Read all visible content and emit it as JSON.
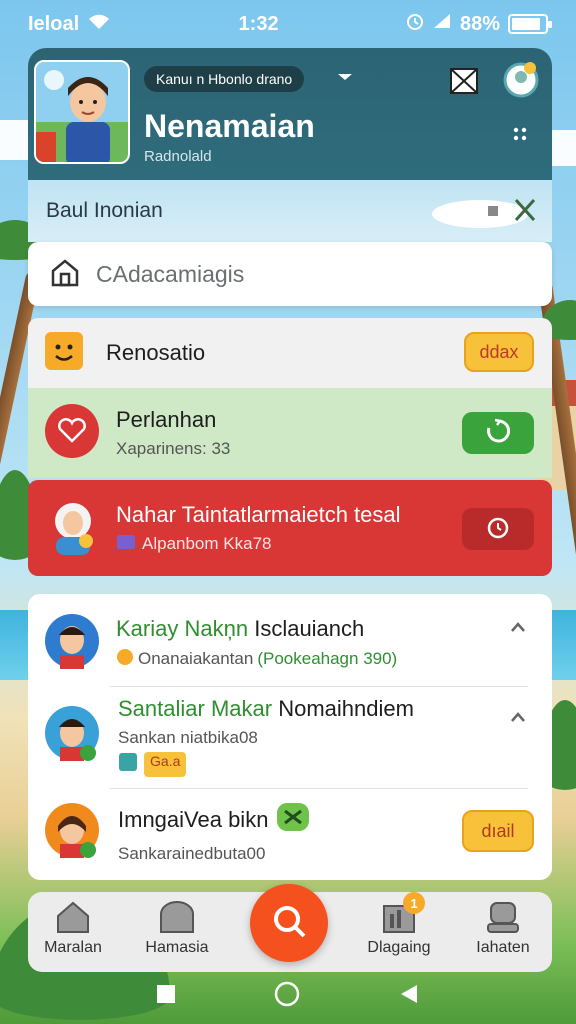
{
  "status_bar": {
    "carrier": "Ieloal",
    "time": "1:32",
    "battery_percent": "88%",
    "battery_level": 0.88
  },
  "header": {
    "pill": "Kanuı n Hbonlo drano",
    "title": "Nenamaian",
    "subtitle": "Radnolald",
    "icons": [
      "play-arrow-icon",
      "mail-icon",
      "profile-badge-icon",
      "dots-icon"
    ]
  },
  "subheader": {
    "label": "Baul Inonian"
  },
  "search": {
    "placeholder": "CAdacamiagis"
  },
  "rows": [
    {
      "title": "Renosatio",
      "button": "ddax",
      "bg": "#f1f1f1",
      "button_color": "#f7c13a"
    },
    {
      "title": "Perlanhan",
      "subtitle": "Xaparinens: 33",
      "bg": "#cfe9c6",
      "button_color": "#3aa33c"
    },
    {
      "title": "Nahar Taintatlarmaietch tesal",
      "subtitle": "Alpanbom Kka78",
      "bg": "#d93636",
      "button_color": "#b92a2a"
    }
  ],
  "contacts": [
    {
      "name_colored": "Kariay Nakņn",
      "name_plain": "Isclauianch",
      "detail_plain": "Onanaiakantan",
      "detail_colored": "(Pookeahagn 390)",
      "badge": ""
    },
    {
      "name_colored": "Santaliar Makar",
      "name_plain": "Nomaihndiem",
      "detail_plain": "Sankan niatbika08",
      "detail_colored": "",
      "badge": "Ga.a"
    },
    {
      "name_colored": "",
      "name_plain": "ImngaiVea bikn",
      "detail_plain": "Sankarainedbuta00",
      "detail_colored": "",
      "badge": "",
      "button": "dıail"
    }
  ],
  "nav": {
    "items": [
      {
        "label": "Maralan",
        "icon": "home-icon"
      },
      {
        "label": "Hamasia",
        "icon": "gallery-icon"
      },
      {
        "label": "Dlagaing",
        "icon": "chart-icon",
        "badge": "1"
      },
      {
        "label": "Iahaten",
        "icon": "person-icon"
      }
    ],
    "fab_icon": "search-icon"
  },
  "colors": {
    "header": "#2c6474",
    "accent_orange": "#f4511e",
    "green": "#3aa33c",
    "red": "#d93636",
    "yellow": "#f7c13a"
  }
}
